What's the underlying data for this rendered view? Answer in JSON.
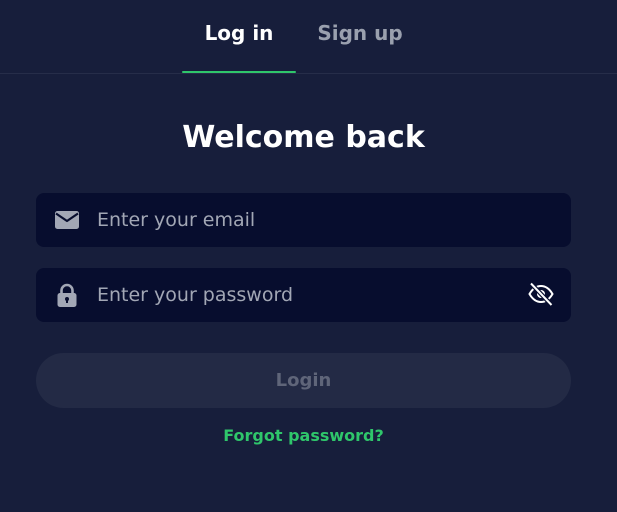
{
  "tabs": {
    "login_label": "Log in",
    "signup_label": "Sign up"
  },
  "heading": "Welcome back",
  "email_field": {
    "placeholder": "Enter your email",
    "value": "",
    "icon": "envelope-icon"
  },
  "password_field": {
    "placeholder": "Enter your password",
    "value": "",
    "icon": "lock-icon",
    "toggle_icon": "eye-off-icon"
  },
  "login_button": {
    "label": "Login"
  },
  "forgot_link": "Forgot password?",
  "colors": {
    "background": "#171e3b",
    "field_background": "#070d2e",
    "accent": "#2fc66b",
    "button_disabled": "#232a45",
    "button_text_disabled": "#5f6579"
  }
}
